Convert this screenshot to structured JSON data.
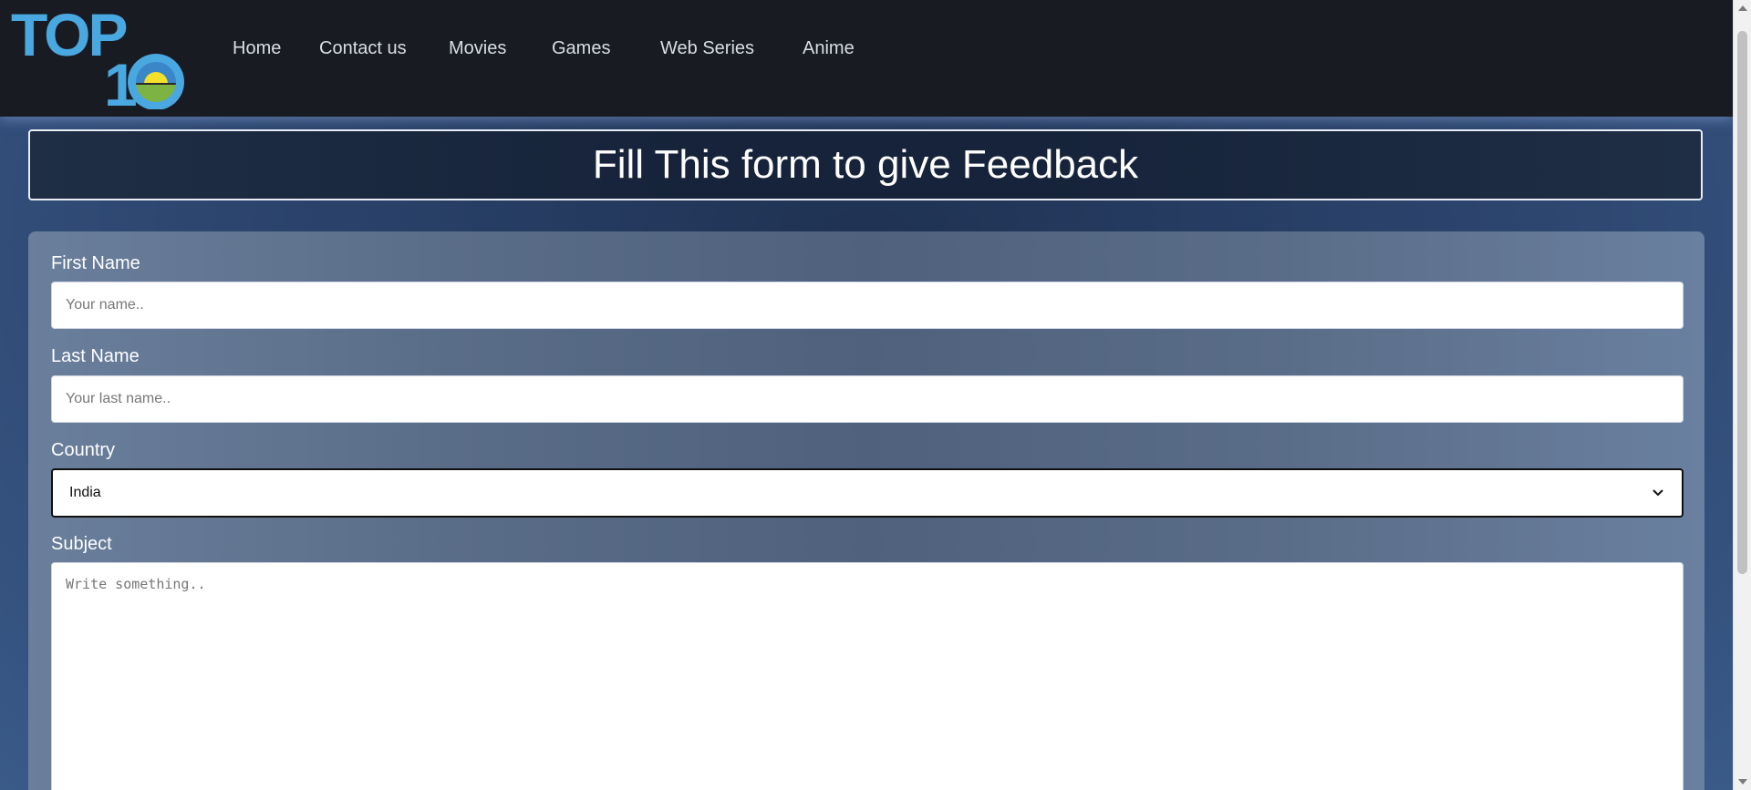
{
  "logo": {
    "text_top": "TOP",
    "text_bottom": "1",
    "icon": "sun-horizon-zero-icon"
  },
  "nav": {
    "items": [
      "Home",
      "Contact us",
      "Movies",
      "Games",
      "Web Series",
      "Anime"
    ]
  },
  "page_title": "Fill This form to give Feedback",
  "form": {
    "first_name": {
      "label": "First Name",
      "placeholder": "Your name..",
      "value": ""
    },
    "last_name": {
      "label": "Last Name",
      "placeholder": "Your last name..",
      "value": ""
    },
    "country": {
      "label": "Country",
      "value": "India",
      "icon": "chevron-down-icon"
    },
    "subject": {
      "label": "Subject",
      "placeholder": "Write something..",
      "value": ""
    }
  },
  "colors": {
    "header_bg": "#181b22",
    "logo_blue": "#4aa8e0",
    "logo_sun": "#f2e02a",
    "logo_green": "#7cb342",
    "title_bg": "#16233a",
    "panel_bg": "#5a6d88"
  }
}
